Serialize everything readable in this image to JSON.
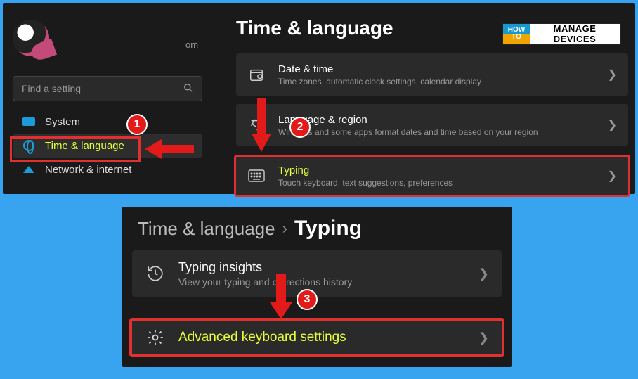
{
  "top": {
    "om": "om",
    "search_placeholder": "Find a setting",
    "page_title": "Time & language",
    "nav": [
      {
        "label": "System"
      },
      {
        "label": "Time & language"
      },
      {
        "label": "Network & internet"
      }
    ],
    "cards": [
      {
        "title": "Date & time",
        "sub": "Time zones, automatic clock settings, calendar display"
      },
      {
        "title": "Language & region",
        "sub": "Windows and some apps format dates and time based on your region"
      },
      {
        "title": "Typing",
        "sub": "Touch keyboard, text suggestions, preferences"
      }
    ]
  },
  "bottom": {
    "breadcrumb": {
      "a": "Time & language",
      "b": "Typing"
    },
    "cards": [
      {
        "title": "Typing insights",
        "sub": "View your typing and corrections history"
      },
      {
        "title": "Advanced keyboard settings"
      }
    ]
  },
  "annotations": {
    "n1": "1",
    "n2": "2",
    "n3": "3"
  },
  "watermark": {
    "how": "HOW",
    "to": "TO",
    "line1": "MANAGE",
    "line2": "DEVICES"
  }
}
